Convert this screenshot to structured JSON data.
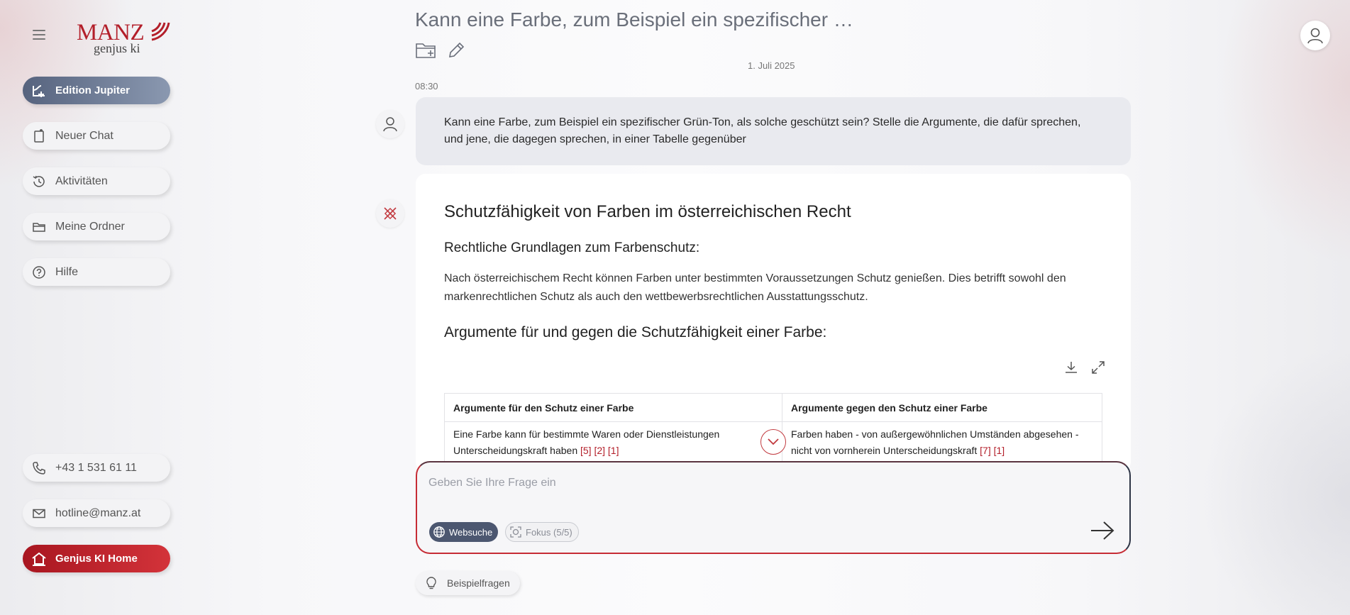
{
  "sidebar": {
    "logo_text": "MANZ",
    "logo_sub": "genjus ki",
    "top_items": [
      {
        "label": "Edition Jupiter",
        "icon": "jupiter-icon"
      },
      {
        "label": "Neuer Chat",
        "icon": "new-chat-icon"
      },
      {
        "label": "Aktivitäten",
        "icon": "history-icon"
      },
      {
        "label": "Meine Ordner",
        "icon": "folder-icon"
      },
      {
        "label": "Hilfe",
        "icon": "help-icon"
      }
    ],
    "bottom_items": [
      {
        "label": "+43 1 531 61 11",
        "icon": "phone-icon"
      },
      {
        "label": "hotline@manz.at",
        "icon": "mail-icon"
      },
      {
        "label": "Genjus KI Home",
        "icon": "home-icon"
      }
    ]
  },
  "header": {
    "title": "Kann eine Farbe, zum Beispiel ein spezifischer …",
    "date": "1. Juli 2025",
    "time": "08:30"
  },
  "user_message": {
    "text": "Kann eine Farbe, zum Beispiel ein spezifischer Grün-Ton, als solche geschützt sein? Stelle die Argumente, die dafür sprechen, und jene, die dagegen sprechen, in einer Tabelle gegenüber"
  },
  "answer": {
    "heading": "Schutzfähigkeit von Farben im österreichischen Recht",
    "subheading1": "Rechtliche Grundlagen zum Farbenschutz:",
    "paragraph": "Nach österreichischem Recht können Farben unter bestimmten Voraussetzungen Schutz genießen. Dies betrifft sowohl den markenrechtlichen Schutz als auch den wettbewerbsrechtlichen Ausstattungsschutz.",
    "subheading2": "Argumente für und gegen die Schutzfähigkeit einer Farbe:",
    "table": {
      "headers": [
        "Argumente für den Schutz einer Farbe",
        "Argumente gegen den Schutz einer Farbe"
      ],
      "rows": [
        {
          "pro_text": "Eine Farbe kann für bestimmte Waren oder Dienstleistungen Unterscheidungskraft haben",
          "pro_cites": "[5] [2] [1]",
          "con_text": "Farben haben - von außergewöhnlichen Umständen abgesehen - nicht von vornherein Unterscheidungskraft",
          "con_cites": "[7] [1]"
        }
      ]
    }
  },
  "composer": {
    "placeholder": "Geben Sie Ihre Frage ein",
    "chip_web": "Websuche",
    "chip_focus": "Fokus (5/5)"
  },
  "example_button": "Beispielfragen",
  "colors": {
    "brand_red": "#b31f2a",
    "jupiter_blue": "#56637e",
    "cite_red": "#b31f2a"
  }
}
